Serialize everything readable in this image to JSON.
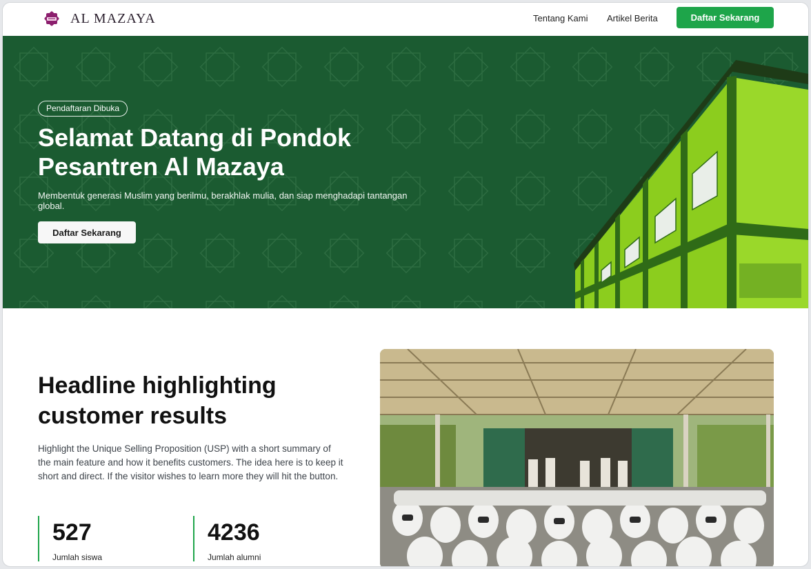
{
  "nav": {
    "brand": "AL MAZAYA",
    "links": [
      "Tentang Kami",
      "Artikel Berita"
    ],
    "cta_label": "Daftar Sekarang"
  },
  "hero": {
    "badge": "Pendaftaran Dibuka",
    "title": "Selamat Datang di Pondok Pesantren Al Mazaya",
    "subtitle": "Membentuk generasi Muslim yang berilmu, berakhlak mulia, dan siap menghadapi tantangan global.",
    "cta_label": "Daftar Sekarang"
  },
  "feature": {
    "headline": "Headline highlighting customer results",
    "description": "Highlight the Unique Selling Proposition (USP) with a short summary of the main feature and how it benefits customers. The idea here is to keep it short and direct. If the visitor wishes to learn more they will hit the button.",
    "stats": [
      {
        "value": "527",
        "label": "Jumlah siswa"
      },
      {
        "value": "4236",
        "label": "Jumlah alumni"
      }
    ]
  },
  "colors": {
    "primary_green": "#1ea54a",
    "hero_bg": "#1b5b31",
    "building_lime": "#8ccd1e"
  },
  "icons": {
    "logo": "al-mazaya-logo-icon"
  }
}
